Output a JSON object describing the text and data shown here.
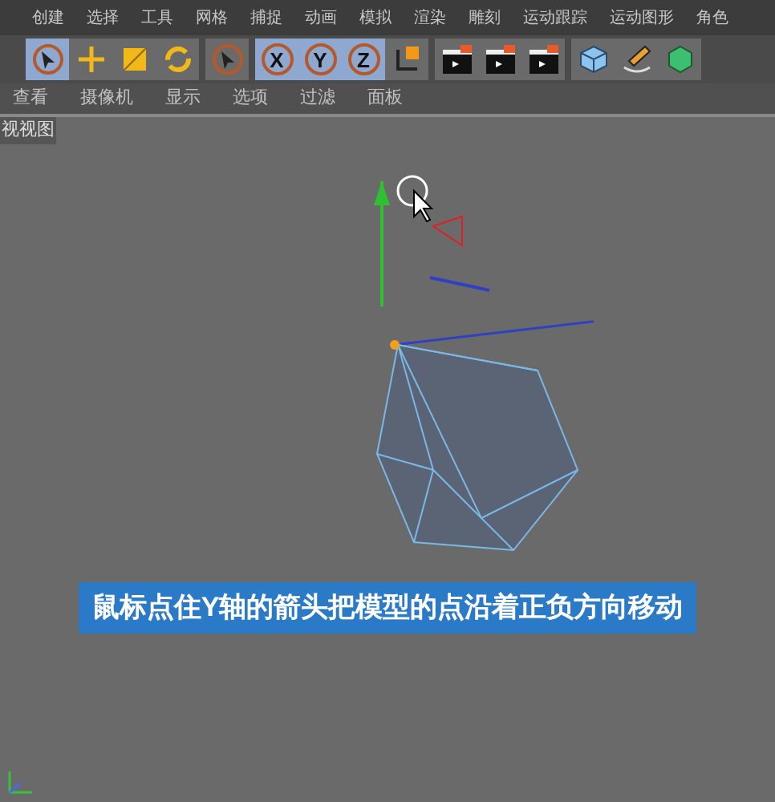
{
  "menu_bar": [
    "创建",
    "选择",
    "工具",
    "网格",
    "捕捉",
    "动画",
    "模拟",
    "渲染",
    "雕刻",
    "运动跟踪",
    "运动图形",
    "角色"
  ],
  "toolbar": [
    {
      "kind": "select",
      "selected": true
    },
    {
      "kind": "move",
      "selected": false
    },
    {
      "kind": "scale",
      "selected": false
    },
    {
      "kind": "rotate",
      "selected": false
    },
    {
      "kind": "gap"
    },
    {
      "kind": "pointer",
      "selected": false
    },
    {
      "kind": "gap"
    },
    {
      "kind": "axis",
      "label": "X",
      "selected": true
    },
    {
      "kind": "axis",
      "label": "Y",
      "selected": true
    },
    {
      "kind": "axis",
      "label": "Z",
      "selected": true
    },
    {
      "kind": "coords",
      "selected": false
    },
    {
      "kind": "gap"
    },
    {
      "kind": "render",
      "selected": false
    },
    {
      "kind": "render",
      "selected": false
    },
    {
      "kind": "render",
      "selected": false
    },
    {
      "kind": "gap"
    },
    {
      "kind": "cube",
      "selected": false
    },
    {
      "kind": "pen",
      "selected": false
    },
    {
      "kind": "gem",
      "selected": false
    }
  ],
  "viewport": {
    "menu": [
      "查看",
      "摄像机",
      "显示",
      "选项",
      "过滤",
      "面板"
    ],
    "label": "视视图",
    "caption": "鼠标点住Y轴的箭头把模型的点沿着正负方向移动"
  }
}
